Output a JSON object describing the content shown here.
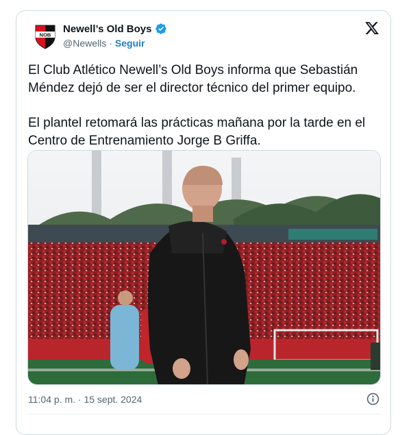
{
  "account": {
    "display_name": "Newell’s Old Boys",
    "handle": "@Newells",
    "separator": "·",
    "follow_label": "Seguir",
    "verified_color": "#1d9bf0",
    "avatar_text": "NOB",
    "avatar_colors": [
      "#d8121f",
      "#111111"
    ]
  },
  "tweet": {
    "paragraphs": [
      "El Club Atlético Newell’s Old Boys informa que Sebastián Méndez dejó de ser el director técnico del primer equipo.",
      "El plantel retomará las prácticas mañana por la tarde en el Centro de Entrenamiento Jorge B Griffa."
    ],
    "timestamp": "11:04 p. m. · 15 sept. 2024"
  },
  "icons": {
    "brand": "x-logo-icon",
    "verified": "verified-badge-icon",
    "info": "info-icon"
  },
  "colors": {
    "text": "#0f1419",
    "secondary": "#536471",
    "link": "#1d7fc4",
    "border": "#cfd9de"
  }
}
